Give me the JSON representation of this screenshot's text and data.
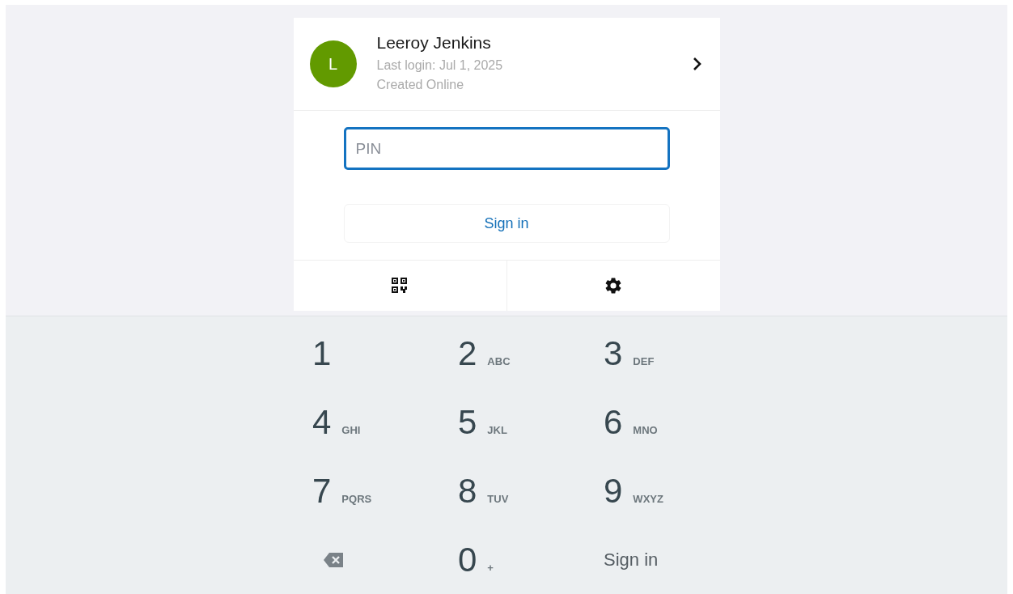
{
  "account": {
    "initial": "L",
    "name": "Leeroy Jenkins",
    "last_login": "Last login: Jul 1, 2025",
    "origin": "Created Online"
  },
  "pin": {
    "placeholder": "PIN"
  },
  "sign_in_button": "Sign in",
  "keypad": [
    {
      "kind": "digit",
      "digit": "1"
    },
    {
      "kind": "digit",
      "digit": "2",
      "letters": "ABC"
    },
    {
      "kind": "digit",
      "digit": "3",
      "letters": "DEF"
    },
    {
      "kind": "digit",
      "digit": "4",
      "letters": "GHI"
    },
    {
      "kind": "digit",
      "digit": "5",
      "letters": "JKL"
    },
    {
      "kind": "digit",
      "digit": "6",
      "letters": "MNO"
    },
    {
      "kind": "digit",
      "digit": "7",
      "letters": "PQRS"
    },
    {
      "kind": "digit",
      "digit": "8",
      "letters": "TUV"
    },
    {
      "kind": "digit",
      "digit": "9",
      "letters": "WXYZ"
    },
    {
      "kind": "backspace"
    },
    {
      "kind": "digit",
      "digit": "0",
      "letters": "+"
    },
    {
      "kind": "action",
      "label": "Sign in"
    }
  ]
}
